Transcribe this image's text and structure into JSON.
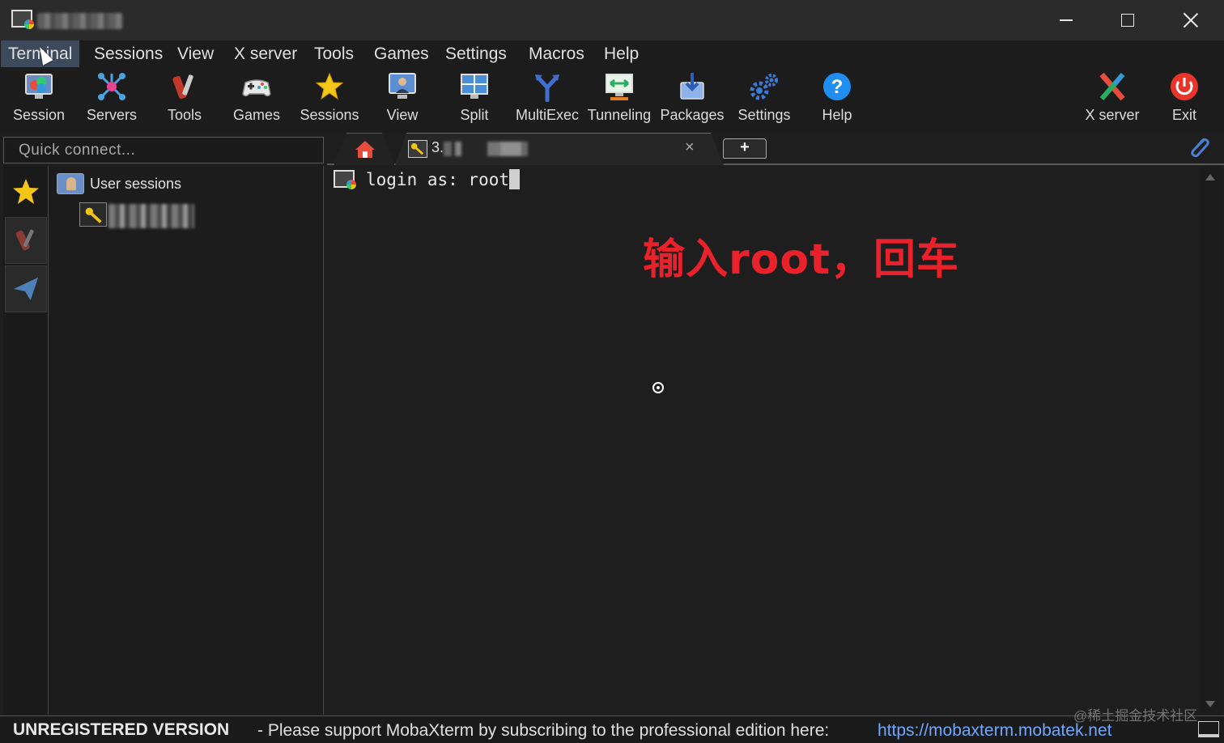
{
  "window": {
    "title_obscured": true
  },
  "menu": [
    "Terminal",
    "Sessions",
    "View",
    "X server",
    "Tools",
    "Games",
    "Settings",
    "Macros",
    "Help"
  ],
  "toolbar": {
    "session": "Session",
    "servers": "Servers",
    "tools": "Tools",
    "games": "Games",
    "sessions": "Sessions",
    "view": "View",
    "split": "Split",
    "multiexec": "MultiExec",
    "tunneling": "Tunneling",
    "packages": "Packages",
    "settings": "Settings",
    "help": "Help",
    "xserver": "X server",
    "exit": "Exit"
  },
  "quick_connect": {
    "placeholder": "Quick connect..."
  },
  "tabs": {
    "active_prefix": "3.",
    "close": "×",
    "add": "+"
  },
  "sidebar": {
    "user_sessions": "User sessions"
  },
  "terminal": {
    "prompt": "login as: root"
  },
  "annotation": "输入root，回车",
  "statusbar": {
    "unregistered": "UNREGISTERED VERSION",
    "message": "-  Please support MobaXterm by subscribing to the professional edition here:",
    "link": "https://mobaxterm.mobatek.net"
  },
  "watermark": "@稀土掘金技术社区",
  "colors": {
    "annotation": "#e8212a",
    "link": "#6fa8ff",
    "active_menu": "#3c4a5c"
  }
}
